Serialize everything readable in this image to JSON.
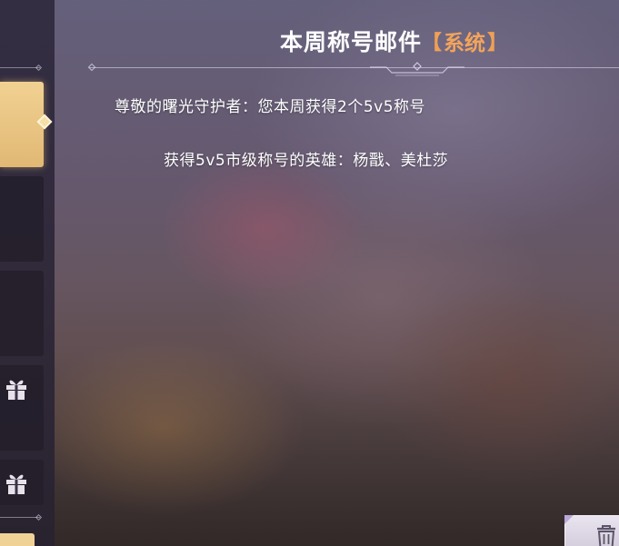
{
  "header": {
    "title": "本周称号邮件",
    "tag_open": "【",
    "tag_label": "系统",
    "tag_close": "】"
  },
  "message": {
    "line1": "尊敬的曙光守护者：您本周获得2个5v5称号",
    "line2": "获得5v5市级称号的英雄：杨戬、美杜莎"
  },
  "sidebar": {
    "tabs": [
      {
        "state": "active"
      },
      {
        "state": "normal"
      },
      {
        "state": "normal"
      },
      {
        "state": "normal",
        "icon": "gift-icon"
      },
      {
        "state": "normal",
        "icon": "gift-icon"
      }
    ]
  },
  "actions": {
    "delete_icon": "trash-icon"
  },
  "colors": {
    "accent_tag": "#f3a45b",
    "active_tab": "#e9c47f",
    "text": "#ffffff"
  }
}
